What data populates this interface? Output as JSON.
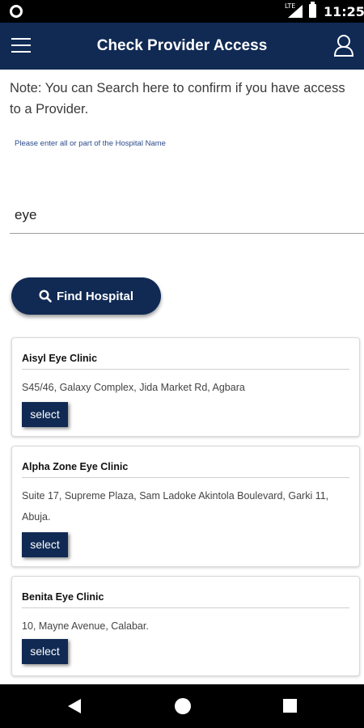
{
  "status_bar": {
    "time": "11:25",
    "network": "LTE"
  },
  "app_bar": {
    "title": "Check Provider Access",
    "menu_icon": "hamburger-menu-icon",
    "profile_icon": "user-profile-icon"
  },
  "note": "Note: You can Search here to confirm if you have access to a Provider.",
  "search": {
    "hint": "Please enter all or part of the Hospital Name",
    "value": "eye"
  },
  "find_button": {
    "label": "Find Hospital",
    "icon": "search-icon"
  },
  "results": [
    {
      "name": "Aisyl Eye Clinic",
      "address": "S45/46, Galaxy Complex, Jida Market Rd, Agbara",
      "select_label": "select"
    },
    {
      "name": "Alpha Zone Eye Clinic",
      "address": "Suite 17, Supreme Plaza, Sam Ladoke Akintola Boulevard, Garki 11, Abuja.",
      "select_label": "select"
    },
    {
      "name": "Benita Eye Clinic",
      "address": "10, Mayne Avenue, Calabar.",
      "select_label": "select"
    }
  ],
  "colors": {
    "primary": "#102a54",
    "hint_text": "#2b4a8a",
    "background": "#ffffff"
  }
}
